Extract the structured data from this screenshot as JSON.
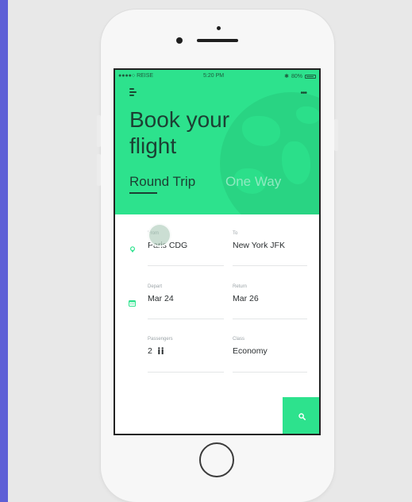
{
  "status_bar": {
    "carrier": "●●●●○ REISE",
    "time": "5:20 PM",
    "battery": "80%"
  },
  "hero": {
    "title_line1": "Book your",
    "title_line2": "flight"
  },
  "trip_tabs": [
    {
      "label": "Round Trip",
      "active": true
    },
    {
      "label": "One Way",
      "active": false
    }
  ],
  "form": {
    "from": {
      "label": "From",
      "value": "Paris CDG"
    },
    "to": {
      "label": "To",
      "value": "New York JFK"
    },
    "depart": {
      "label": "Depart",
      "value": "Mar 24"
    },
    "return": {
      "label": "Return",
      "value": "Mar 26"
    },
    "passengers": {
      "label": "Passengers",
      "value": "2"
    },
    "class": {
      "label": "Class",
      "value": "Economy"
    }
  },
  "icons": {
    "menu": "menu-icon",
    "more": "more-icon",
    "location": "location-pin-icon",
    "calendar": "calendar-icon",
    "passengers": "people-icon",
    "search": "search-icon"
  },
  "colors": {
    "accent": "#2de28d",
    "text_dark": "#1c3f33",
    "tab_inactive": "#8fe9c0"
  }
}
